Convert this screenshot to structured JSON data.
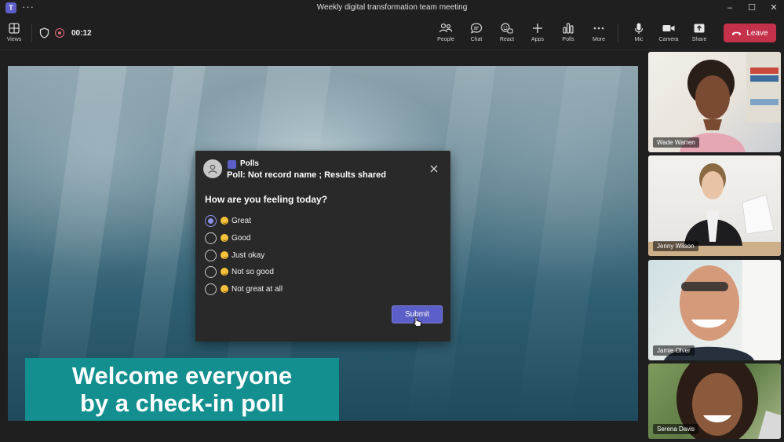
{
  "window": {
    "title": "Weekly digital transformation team meeting",
    "app_logo": "T",
    "menu_dots": "···",
    "controls": {
      "minimize": "–",
      "maximize": "☐",
      "close": "✕"
    }
  },
  "toolbar": {
    "views_label": "Views",
    "timer": "00:12",
    "people_label": "People",
    "chat_label": "Chat",
    "react_label": "React",
    "apps_label": "Apps",
    "polls_label": "Polls",
    "more_label": "More",
    "mic_label": "Mic",
    "camera_label": "Camera",
    "share_label": "Share",
    "leave_label": "Leave"
  },
  "poll": {
    "app_name": "Polls",
    "subtitle": "Poll: Not record name ; Results shared",
    "question": "How are you feeling today?",
    "options": [
      {
        "label": "Great",
        "selected": true
      },
      {
        "label": "Good",
        "selected": false
      },
      {
        "label": "Just okay",
        "selected": false
      },
      {
        "label": "Not so good",
        "selected": false
      },
      {
        "label": "Not great at all",
        "selected": false
      }
    ],
    "submit_label": "Submit"
  },
  "banner": {
    "line1": "Welcome everyone",
    "line2": "by a check-in poll"
  },
  "participants": [
    {
      "name": "Wade Warren"
    },
    {
      "name": "Jenny Wilson"
    },
    {
      "name": "Jamie Olver"
    },
    {
      "name": "Serena Davis"
    }
  ],
  "colors": {
    "accent": "#5b5fc7",
    "leave": "#c4314b",
    "banner": "#138f8f",
    "recording": "#e7697a"
  }
}
